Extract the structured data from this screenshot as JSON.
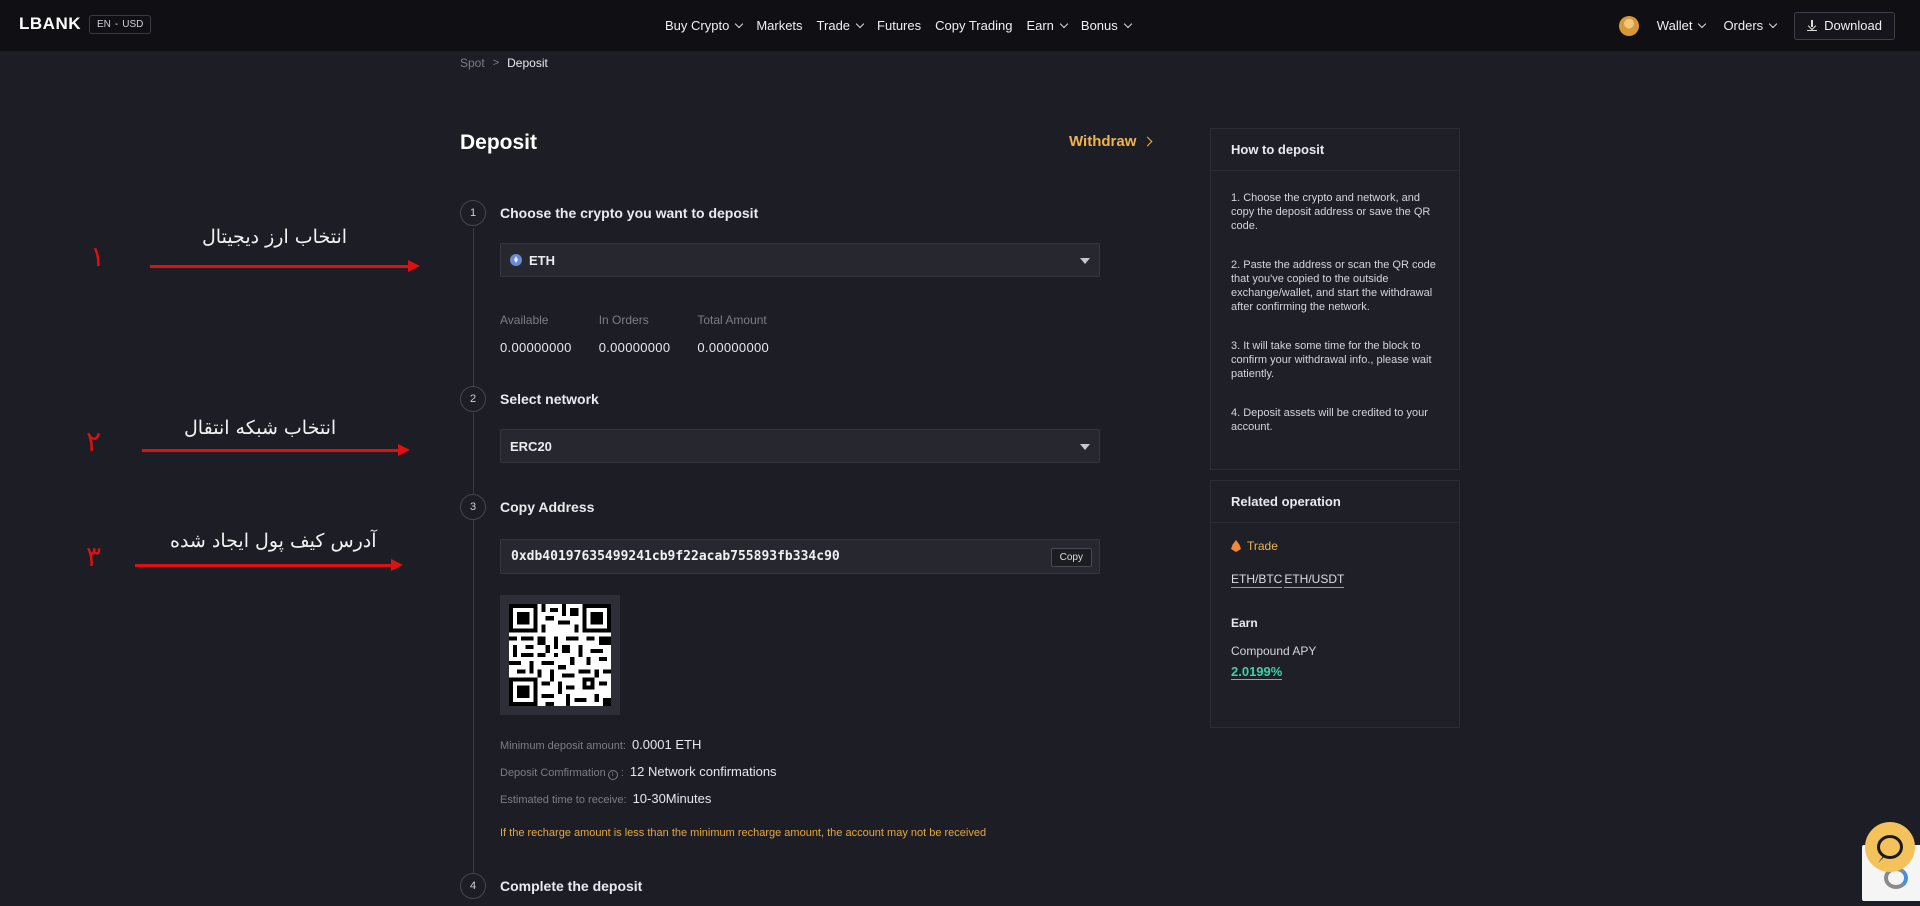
{
  "header": {
    "logo": "LBANK",
    "lang": "EN",
    "lang_sep": "-",
    "currency": "USD",
    "nav": [
      {
        "label": "Buy Crypto",
        "dropdown": true
      },
      {
        "label": "Markets",
        "dropdown": false
      },
      {
        "label": "Trade",
        "dropdown": true
      },
      {
        "label": "Futures",
        "dropdown": false
      },
      {
        "label": "Copy Trading",
        "dropdown": false
      },
      {
        "label": "Earn",
        "dropdown": true
      },
      {
        "label": "Bonus",
        "dropdown": true
      }
    ],
    "wallet": "Wallet",
    "orders": "Orders",
    "download": "Download"
  },
  "breadcrumb": {
    "parent": "Spot",
    "sep": ">",
    "current": "Deposit"
  },
  "main": {
    "title": "Deposit",
    "withdraw": "Withdraw",
    "step1": {
      "num": "1",
      "title": "Choose the crypto you want to deposit",
      "selected": "ETH"
    },
    "balances": [
      {
        "label": "Available",
        "value": "0.00000000"
      },
      {
        "label": "In Orders",
        "value": "0.00000000"
      },
      {
        "label": "Total Amount",
        "value": "0.00000000"
      }
    ],
    "step2": {
      "num": "2",
      "title": "Select network",
      "selected": "ERC20"
    },
    "step3": {
      "num": "3",
      "title": "Copy Address",
      "address": "0xdb40197635499241cb9f22acab755893fb334c90",
      "copy": "Copy"
    },
    "min_deposit": {
      "label": "Minimum deposit amount:",
      "value": "0.0001 ETH"
    },
    "confirmation": {
      "label": "Deposit Comfirmation",
      "colon": ":",
      "value": "12 Network confirmations"
    },
    "estimated": {
      "label": "Estimated time to receive:",
      "value": "10-30Minutes"
    },
    "warning": "If the recharge amount is less than the minimum recharge amount, the account may not be received",
    "step4": {
      "num": "4",
      "title": "Complete the deposit"
    }
  },
  "sidebar": {
    "how_title": "How to deposit",
    "how_items": [
      "1. Choose the crypto and network, and copy the deposit address or save the QR code.",
      "2. Paste the address or scan the QR code that you've copied to the outside exchange/wallet, and start the withdrawal after confirming the network.",
      "3. It will take some time for the block to confirm your withdrawal info., please wait patiently.",
      "4. Deposit assets will be credited to your account."
    ],
    "related_title": "Related operation",
    "trade_label": "Trade",
    "pairs": [
      "ETH/BTC",
      "ETH/USDT"
    ],
    "earn_title": "Earn",
    "apy_label": "Compound APY",
    "apy_value": "2.0199%"
  },
  "annotations": [
    {
      "num": "١",
      "text": "انتخاب ارز دیجیتال"
    },
    {
      "num": "٢",
      "text": "انتخاب شبکه انتقال"
    },
    {
      "num": "٣",
      "text": "آدرس کیف پول ایجاد شده"
    }
  ],
  "colors": {
    "accent": "#f0b44c",
    "green": "#3dd1a6",
    "annotation": "#e01010",
    "background": "#1d1d26"
  },
  "icons": [
    "chevron-down-icon",
    "download-icon",
    "eth-icon",
    "fire-icon",
    "info-icon",
    "chat-icon",
    "avatar-icon"
  ]
}
